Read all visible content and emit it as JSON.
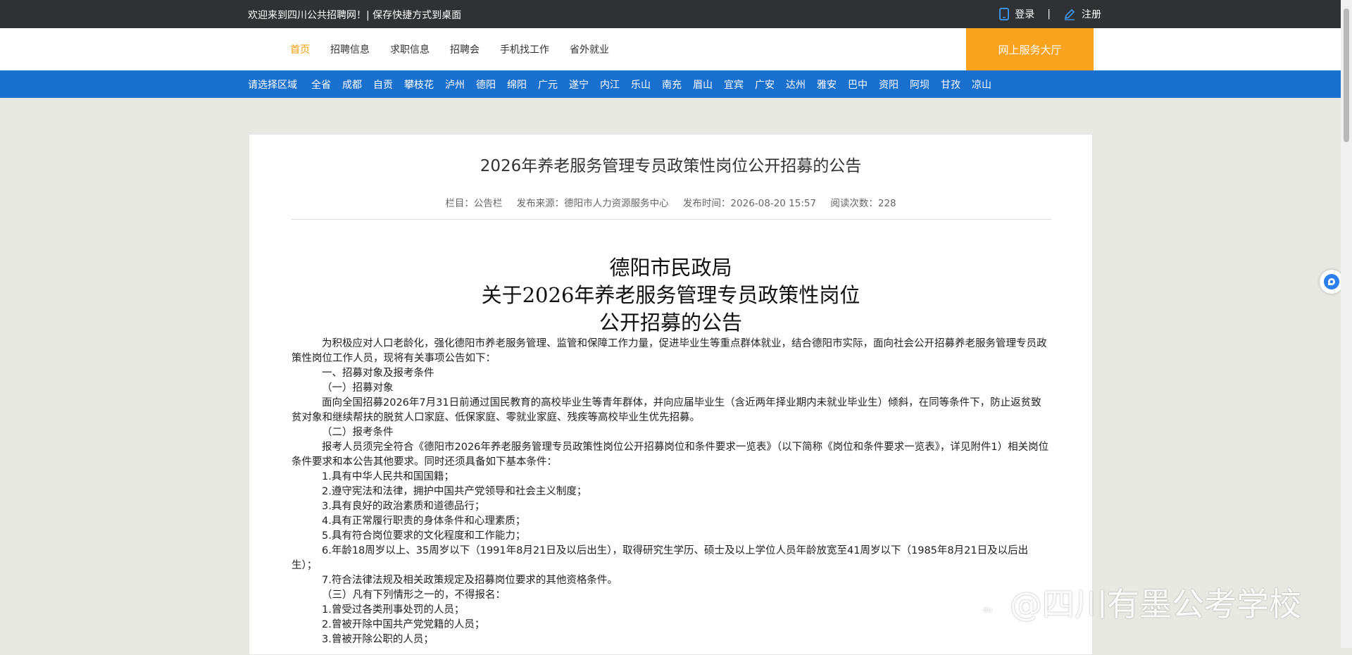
{
  "topbar": {
    "welcome": "欢迎来到四川公共招聘网！| 保存快捷方式到桌面",
    "login": "登录",
    "separator": "|",
    "register": "注册"
  },
  "nav": {
    "items": [
      "首页",
      "招聘信息",
      "求职信息",
      "招聘会",
      "手机找工作",
      "省外就业"
    ],
    "service_button": "网上服务大厅"
  },
  "regions": {
    "label": "请选择区域",
    "items": [
      "全省",
      "成都",
      "自贡",
      "攀枝花",
      "泸州",
      "德阳",
      "绵阳",
      "广元",
      "遂宁",
      "内江",
      "乐山",
      "南充",
      "眉山",
      "宜宾",
      "广安",
      "达州",
      "雅安",
      "巴中",
      "资阳",
      "阿坝",
      "甘孜",
      "凉山"
    ]
  },
  "article": {
    "title": "2026年养老服务管理专员政策性岗位公开招募的公告",
    "meta": {
      "column": "栏目：公告栏",
      "source": "发布来源：德阳市人力资源服务中心",
      "time": "发布时间：2026-08-20 15:57",
      "views": "阅读次数：228"
    },
    "doc_head": [
      "德阳市民政局",
      "关于2026年养老服务管理专员政策性岗位",
      "公开招募的公告"
    ],
    "paragraphs": [
      "为积极应对人口老龄化，强化德阳市养老服务管理、监管和保障工作力量，促进毕业生等重点群体就业，结合德阳市实际，面向社会公开招募养老服务管理专员政策性岗位工作人员，现将有关事项公告如下：",
      "一、招募对象及报考条件",
      "（一）招募对象",
      "面向全国招募2026年7月31日前通过国民教育的高校毕业生等青年群体，并向应届毕业生（含近两年择业期内未就业毕业生）倾斜，在同等条件下，防止返贫致贫对象和继续帮扶的脱贫人口家庭、低保家庭、零就业家庭、残疾等高校毕业生优先招募。",
      "（二）报考条件",
      "报考人员须完全符合《德阳市2026年养老服务管理专员政策性岗位公开招募岗位和条件要求一览表》（以下简称《岗位和条件要求一览表》，详见附件1）相关岗位条件要求和本公告其他要求。同时还须具备如下基本条件：",
      "1.具有中华人民共和国国籍；",
      "2.遵守宪法和法律，拥护中国共产党领导和社会主义制度；",
      "3.具有良好的政治素质和道德品行；",
      "4.具有正常履行职责的身体条件和心理素质；",
      "5.具有符合岗位要求的文化程度和工作能力；",
      "6.年龄18周岁以上、35周岁以下（1991年8月21日及以后出生），取得研究生学历、硕士及以上学位人员年龄放宽至41周岁以下（1985年8月21日及以后出生）；",
      "7.符合法律法规及相关政策规定及招募岗位要求的其他资格条件。",
      "（三）凡有下列情形之一的，不得报名：",
      "1.曾受过各类刑事处罚的人员；",
      "2.曾被开除中国共产党党籍的人员；",
      "3.曾被开除公职的人员；"
    ]
  },
  "watermark": "@四川有墨公考学校",
  "colors": {
    "topbar": "#2f3134",
    "accent_orange": "#f8a21d",
    "region_blue": "#1a70cf",
    "active_nav": "#f29b06"
  }
}
